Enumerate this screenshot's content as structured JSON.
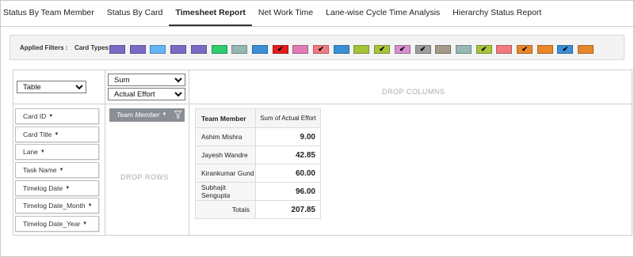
{
  "tabs": [
    {
      "label": "Status By Team Member",
      "active": false
    },
    {
      "label": "Status By Card",
      "active": false
    },
    {
      "label": "Timesheet Report",
      "active": true
    },
    {
      "label": "Net Work Time",
      "active": false
    },
    {
      "label": "Lane-wise Cycle Time Analysis",
      "active": false
    },
    {
      "label": "Hierarchy Status Report",
      "active": false
    }
  ],
  "filters": {
    "applied_label": "Applied Filters :",
    "card_types_label": "Card Types:",
    "card_types": [
      {
        "color": "#7c6bc4",
        "checked": false
      },
      {
        "color": "#7c6bc4",
        "checked": false
      },
      {
        "color": "#64b5f6",
        "checked": false
      },
      {
        "color": "#7c6bc4",
        "checked": false
      },
      {
        "color": "#7c6bc4",
        "checked": false
      },
      {
        "color": "#2ecc71",
        "checked": false
      },
      {
        "color": "#95b8b2",
        "checked": false
      },
      {
        "color": "#3a8fd6",
        "checked": false
      },
      {
        "color": "#e31d1d",
        "checked": true
      },
      {
        "color": "#e07bb5",
        "checked": false
      },
      {
        "color": "#f07a80",
        "checked": true
      },
      {
        "color": "#3a8fd6",
        "checked": false
      },
      {
        "color": "#a6c43b",
        "checked": false
      },
      {
        "color": "#a6c43b",
        "checked": true
      },
      {
        "color": "#d78fd0",
        "checked": true
      },
      {
        "color": "#9e9e9e",
        "checked": true
      },
      {
        "color": "#a39a88",
        "checked": false
      },
      {
        "color": "#95b8b2",
        "checked": false
      },
      {
        "color": "#a6c43b",
        "checked": true
      },
      {
        "color": "#f07a80",
        "checked": false
      },
      {
        "color": "#e8862a",
        "checked": true
      },
      {
        "color": "#e8862a",
        "checked": false
      },
      {
        "color": "#3a8fd6",
        "checked": true
      },
      {
        "color": "#e8862a",
        "checked": false
      }
    ]
  },
  "pivot": {
    "renderer": "Table",
    "aggregator": "Sum",
    "aggregate_field": "Actual Effort",
    "drop_columns_text": "DROP COLUMNS",
    "drop_rows_text": "DROP ROWS",
    "row_field": "Team Member",
    "available_fields": [
      "Card ID",
      "Card Title",
      "Lane",
      "Task Name",
      "Timelog Date",
      "Timelog Date_Month",
      "Timelog Date_Year"
    ]
  },
  "result": {
    "row_header": "Team Member",
    "value_header": "Sum of Actual Effort",
    "rows": [
      {
        "name": "Ashim Mishra",
        "value": "9.00"
      },
      {
        "name": "Jayesh Wandre",
        "value": "42.85"
      },
      {
        "name": "Kirankumar Gund",
        "value": "60.00"
      },
      {
        "name": "Subhajit Sengupta",
        "value": "96.00"
      }
    ],
    "totals_label": "Totals",
    "totals_value": "207.85"
  }
}
